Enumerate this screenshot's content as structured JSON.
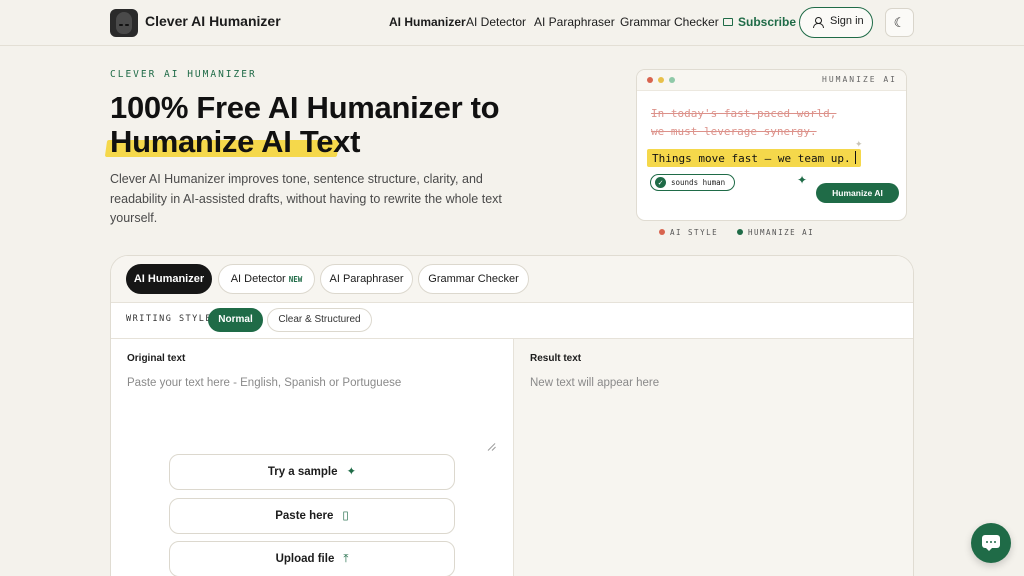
{
  "header": {
    "brand": "Clever AI Humanizer",
    "nav": [
      "AI Humanizer",
      "AI Detector",
      "AI Paraphraser",
      "Grammar Checker"
    ],
    "subscribe": "Subscribe",
    "signin": "Sign in",
    "theme_icon": "moon-icon"
  },
  "hero": {
    "eyebrow": "CLEVER AI HUMANIZER",
    "title_line1": "100% Free AI Humanizer to",
    "title_line2": "Humanize AI Text",
    "subtitle": "Clever AI Humanizer improves tone, sentence structure, clarity, and readability in AI-assisted drafts, without having to rewrite the whole text yourself."
  },
  "preview": {
    "title": "HUMANIZE AI",
    "strike_line1": "In today's fast-paced world,",
    "strike_line2": "we must leverage synergy.",
    "new_line": "Things move fast — we team up.",
    "badge": "sounds human",
    "button": "Humanize AI",
    "legend_ai": "AI STYLE",
    "legend_human": "HUMANIZE AI",
    "colors": {
      "red": "#d8644f",
      "yellow": "#e8c04a",
      "green": "#8fc9a8",
      "accent": "#1f6b47",
      "highlight": "#f5d84b"
    }
  },
  "tool": {
    "tabs": [
      "AI Humanizer",
      "AI Detector",
      "AI Paraphraser",
      "Grammar Checker"
    ],
    "new_badge": "NEW",
    "writing_style_label": "WRITING STYLE",
    "styles": [
      "Normal",
      "Clear & Structured"
    ],
    "original_label": "Original text",
    "original_placeholder": "Paste your text here - English, Spanish or Portuguese",
    "result_label": "Result text",
    "result_placeholder": "New text will appear here",
    "actions": [
      "Try a sample",
      "Paste here",
      "Upload file"
    ]
  }
}
